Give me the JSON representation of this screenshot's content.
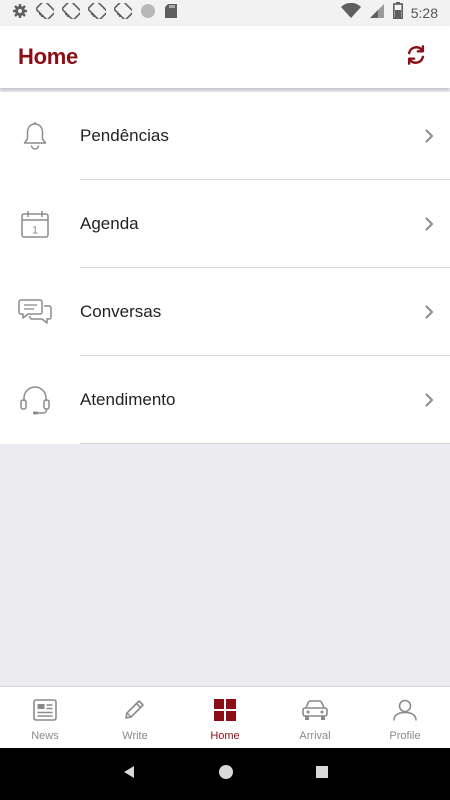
{
  "status_bar": {
    "time": "5:28",
    "icons": [
      "gear-icon",
      "cast-icon",
      "cast-icon",
      "cast-icon",
      "cast-icon",
      "circle-icon",
      "sd-card-icon",
      "wifi-icon",
      "signal-icon",
      "battery-icon"
    ]
  },
  "app_bar": {
    "title": "Home",
    "refresh_icon": "refresh-icon",
    "accent_color": "#8b0e17"
  },
  "menu": {
    "items": [
      {
        "label": "Pendências",
        "icon": "bell-icon"
      },
      {
        "label": "Agenda",
        "icon": "calendar-icon",
        "icon_text": "1"
      },
      {
        "label": "Conversas",
        "icon": "chat-bubbles-icon"
      },
      {
        "label": "Atendimento",
        "icon": "headset-icon"
      }
    ]
  },
  "bottom_nav": {
    "items": [
      {
        "label": "News",
        "icon": "newspaper-icon",
        "active": false
      },
      {
        "label": "Write",
        "icon": "pencil-icon",
        "active": false
      },
      {
        "label": "Home",
        "icon": "grid-icon",
        "active": true
      },
      {
        "label": "Arrival",
        "icon": "car-icon",
        "active": false
      },
      {
        "label": "Profile",
        "icon": "person-icon",
        "active": false
      }
    ]
  },
  "system_nav": {
    "buttons": [
      "back-icon",
      "home-circle-icon",
      "recents-square-icon"
    ]
  }
}
